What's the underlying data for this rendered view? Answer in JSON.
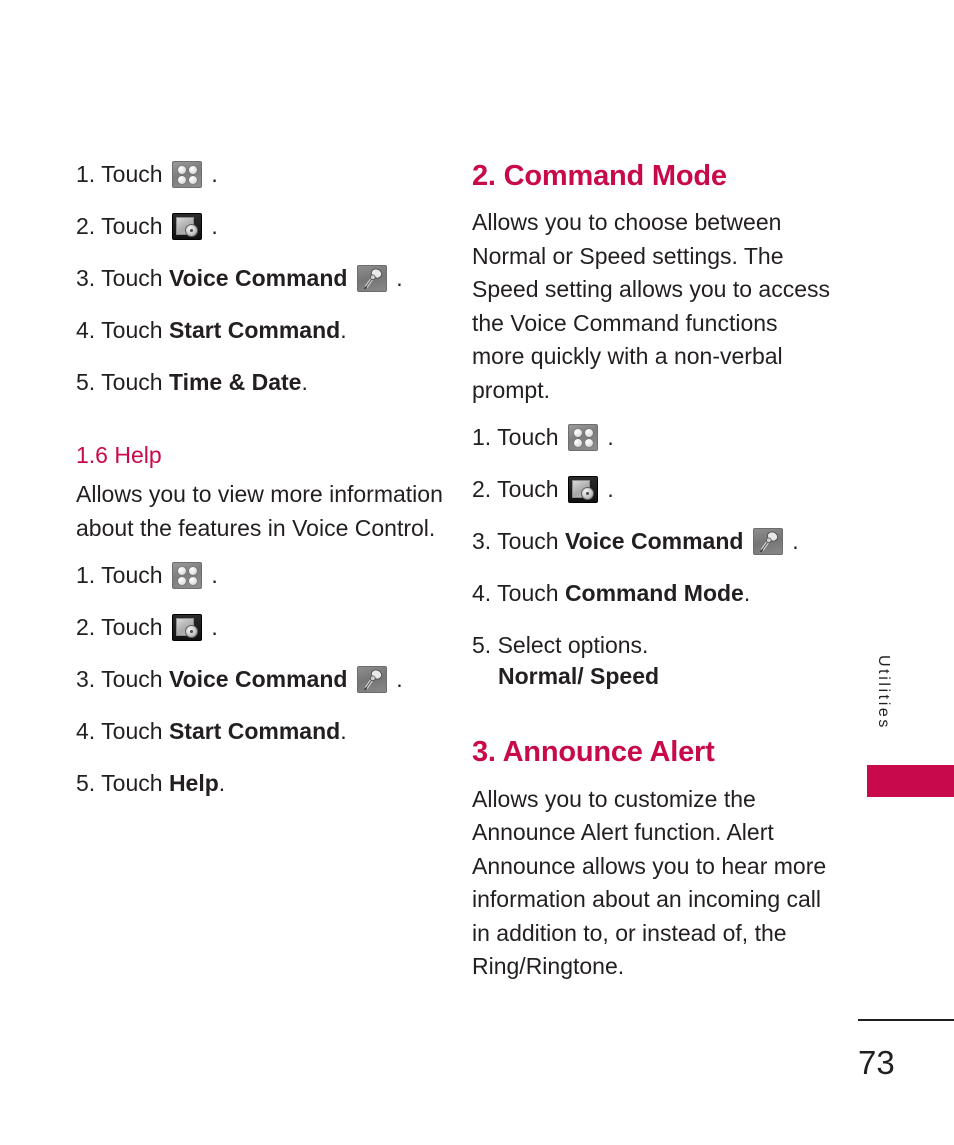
{
  "page": {
    "number": "73",
    "side_tab_label": "Utilities",
    "accent_color": "#c8094b",
    "text_color": "#231f20"
  },
  "left_column": {
    "steps_top": [
      {
        "num": "1.",
        "text": "Touch",
        "icon": "grid-menu-icon",
        "bold": "",
        "tail": "."
      },
      {
        "num": "2.",
        "text": "Touch",
        "icon": "tools-settings-icon",
        "bold": "",
        "tail": "."
      },
      {
        "num": "3.",
        "text": "Touch",
        "icon": "microphone-icon",
        "bold": "Voice Command",
        "tail": "."
      },
      {
        "num": "4.",
        "text": "Touch",
        "icon": "",
        "bold": "Start Command",
        "tail": "."
      },
      {
        "num": "5.",
        "text": "Touch",
        "icon": "",
        "bold": "Time & Date",
        "tail": "."
      }
    ],
    "section": {
      "heading": "1.6 Help",
      "body": "Allows you to view more information about the features in Voice Control.",
      "steps": [
        {
          "num": "1.",
          "text": "Touch",
          "icon": "grid-menu-icon",
          "bold": "",
          "tail": "."
        },
        {
          "num": "2.",
          "text": "Touch",
          "icon": "tools-settings-icon",
          "bold": "",
          "tail": "."
        },
        {
          "num": "3.",
          "text": "Touch",
          "icon": "microphone-icon",
          "bold": "Voice Command",
          "tail": "."
        },
        {
          "num": "4.",
          "text": "Touch",
          "icon": "",
          "bold": "Start Command",
          "tail": "."
        },
        {
          "num": "5.",
          "text": "Touch",
          "icon": "",
          "bold": "Help",
          "tail": "."
        }
      ]
    }
  },
  "right_column": {
    "section_command_mode": {
      "heading": "2. Command Mode",
      "body": "Allows you to choose between Normal or Speed settings. The Speed setting allows you to access the Voice Command functions more quickly with a non-verbal prompt.",
      "steps": [
        {
          "num": "1.",
          "text": "Touch",
          "icon": "grid-menu-icon",
          "bold": "",
          "tail": "."
        },
        {
          "num": "2.",
          "text": "Touch",
          "icon": "tools-settings-icon",
          "bold": "",
          "tail": "."
        },
        {
          "num": "3.",
          "text": "Touch",
          "icon": "microphone-icon",
          "bold": "Voice Command",
          "tail": "."
        },
        {
          "num": "4.",
          "text": "Touch",
          "icon": "",
          "bold": "Command Mode",
          "tail": "."
        },
        {
          "num": "5.",
          "text": "Select options.",
          "icon": "",
          "bold": "",
          "tail": "",
          "extra": "Normal/ Speed"
        }
      ]
    },
    "section_announce_alert": {
      "heading": "3. Announce Alert",
      "body": "Allows you to customize the Announce Alert function. Alert Announce allows you to hear more information about an incoming call in addition to, or instead of, the Ring/Ringtone."
    }
  }
}
